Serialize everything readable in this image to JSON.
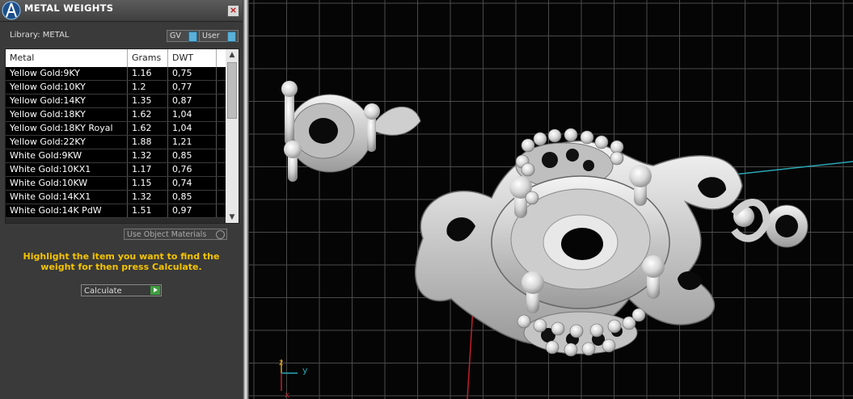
{
  "window": {
    "title": "METAL WEIGHTS",
    "close_label": "×"
  },
  "library": {
    "label": "Library: METAL"
  },
  "toggles": [
    {
      "label": "GV"
    },
    {
      "label": "User"
    }
  ],
  "table": {
    "columns": [
      "Metal",
      "Grams",
      "DWT"
    ],
    "rows": [
      [
        "Yellow Gold:9KY",
        "1.16",
        "0,75"
      ],
      [
        "Yellow Gold:10KY",
        "1.2",
        "0,77"
      ],
      [
        "Yellow Gold:14KY",
        "1.35",
        "0,87"
      ],
      [
        "Yellow Gold:18KY",
        "1.62",
        "1,04"
      ],
      [
        "Yellow Gold:18KY Royal",
        "1.62",
        "1,04"
      ],
      [
        "Yellow Gold:22KY",
        "1.88",
        "1,21"
      ],
      [
        "White Gold:9KW",
        "1.32",
        "0,85"
      ],
      [
        "White Gold:10KX1",
        "1.17",
        "0,76"
      ],
      [
        "White Gold:10KW",
        "1.15",
        "0,74"
      ],
      [
        "White Gold:14KX1",
        "1.32",
        "0,85"
      ],
      [
        "White Gold:14K PdW",
        "1.51",
        "0,97"
      ]
    ],
    "scroll_up": "▲",
    "scroll_down": "▼"
  },
  "use_object_materials": {
    "label": "Use Object Materials"
  },
  "hint": "Highlight the item you want to find the weight for then press Calculate.",
  "calculate": {
    "label": "Calculate"
  },
  "axes": {
    "z": "z",
    "y": "y",
    "x": "x"
  },
  "colors": {
    "hint": "#f5c400",
    "grid": "#4a4a4a",
    "axis_x": "#c0202a",
    "axis_y": "#2aa7b5",
    "model": "#d9d9d9"
  }
}
